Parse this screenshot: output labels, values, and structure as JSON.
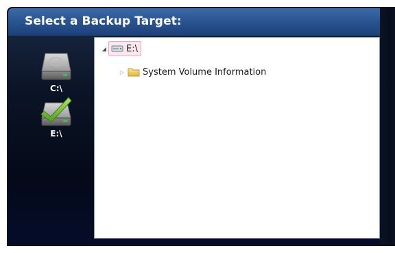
{
  "window": {
    "title": "Select a Backup Target:"
  },
  "drives": [
    {
      "label": "C:\\",
      "icon": "hard-drive-icon",
      "selected": false
    },
    {
      "label": "E:\\",
      "icon": "hard-drive-checked-icon",
      "selected": true
    }
  ],
  "tree": {
    "root": {
      "label": "E:\\",
      "icon": "drive-icon",
      "expanded": true,
      "selected": true
    },
    "children": [
      {
        "label": "System Volume Information",
        "icon": "folder-icon",
        "expanded": false
      }
    ]
  },
  "colors": {
    "title_bar": "#2a5592",
    "background": "#050c1e",
    "selection_border": "#e8a9b8",
    "selection_fill": "#fbe8ee",
    "folder": "#f2c94c",
    "checkmark": "#7cc242"
  }
}
